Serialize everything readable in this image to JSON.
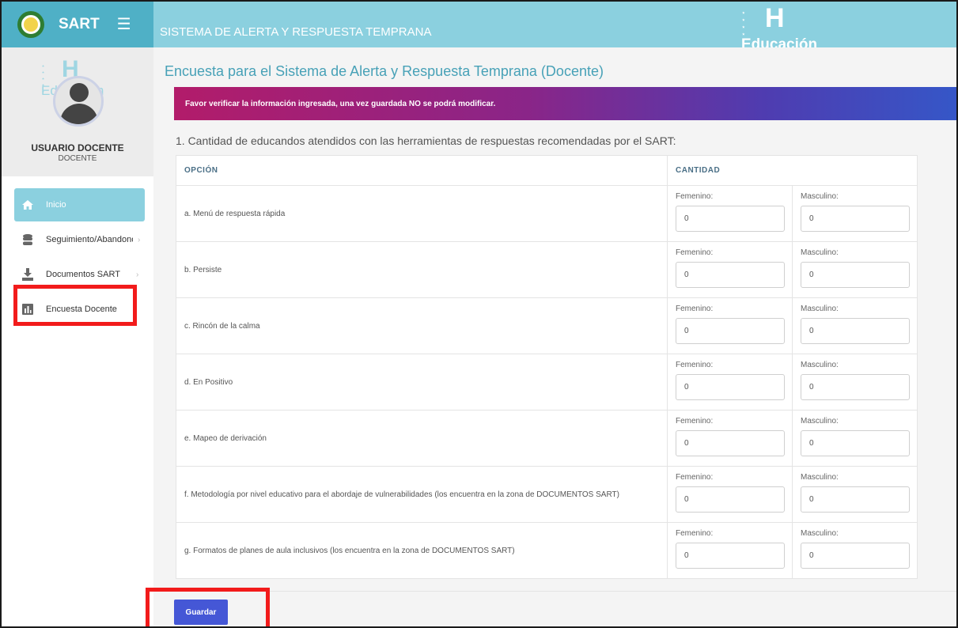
{
  "app": {
    "brand": "SART",
    "header_title": "SISTEMA DE ALERTA Y RESPUESTA TEMPRANA",
    "logo_text": "Educación",
    "logo_mark": "H",
    "logo_stars": "⋆ ⋆ ⋆\n⋆ ⋆"
  },
  "user": {
    "name": "USUARIO DOCENTE",
    "role": "DOCENTE"
  },
  "sidebar": {
    "items": [
      {
        "label": "Inicio",
        "icon": "home-icon",
        "active": true
      },
      {
        "label": "Seguimiento/Abandono",
        "icon": "database-icon",
        "chevron": "›"
      },
      {
        "label": "Documentos SART",
        "icon": "download-icon",
        "chevron": "›"
      },
      {
        "label": "Encuesta Docente",
        "icon": "bar-chart-icon"
      }
    ]
  },
  "main": {
    "title": "Encuesta para el Sistema de Alerta y Respuesta Temprana (Docente)",
    "alert": "Favor verificar la información ingresada, una vez guardada NO se podrá modificar.",
    "question": "1. Cantidad de educandos atendidos con las herramientas de respuestas recomendadas por el SART:",
    "columns": {
      "option": "OPCIÓN",
      "quantity": "CANTIDAD"
    },
    "field_labels": {
      "female": "Femenino:",
      "male": "Masculino:"
    },
    "rows": [
      {
        "option": "a. Menú de respuesta rápida",
        "female": "0",
        "male": "0"
      },
      {
        "option": "b. Persiste",
        "female": "0",
        "male": "0"
      },
      {
        "option": "c. Rincón de la calma",
        "female": "0",
        "male": "0"
      },
      {
        "option": "d. En Positivo",
        "female": "0",
        "male": "0"
      },
      {
        "option": "e. Mapeo de derivación",
        "female": "0",
        "male": "0"
      },
      {
        "option": "f. Metodología por nivel educativo para el abordaje de vulnerabilidades (los encuentra en la zona de DOCUMENTOS SART)",
        "female": "0",
        "male": "0"
      },
      {
        "option": "g. Formatos de planes de aula inclusivos (los encuentra en la zona de DOCUMENTOS SART)",
        "female": "0",
        "male": "0"
      }
    ],
    "save_label": "Guardar"
  },
  "colors": {
    "accent": "#8bd0df",
    "brand": "#4fb0c6",
    "button": "#4557d6",
    "highlight": "#f21b1b"
  }
}
